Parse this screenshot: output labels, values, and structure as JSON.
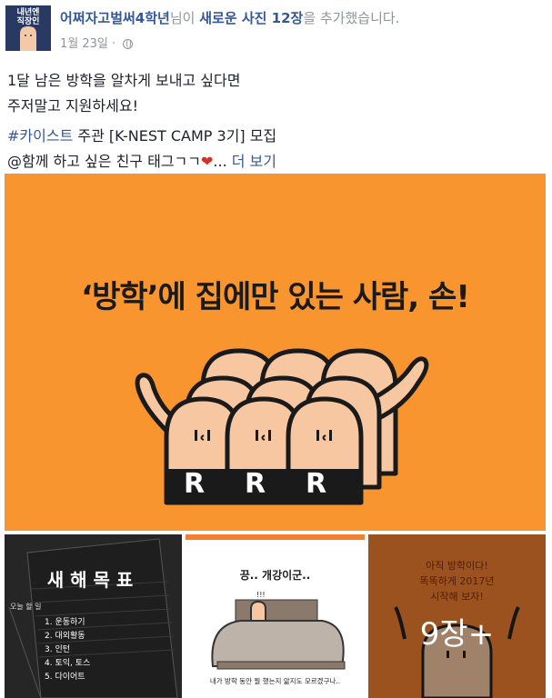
{
  "post": {
    "author": "어쩌자고벌써4학년",
    "action_mid": "님이 ",
    "highlight": "새로운 사진 12장",
    "action_end": "을 추가했습니다.",
    "date": "1월 23일",
    "date_sep": "·",
    "avatar_text": "내년엔\n직장인"
  },
  "body": {
    "line1": "1달 남은 방학을 알차게 보내고 싶다면",
    "line2": "주저말고 지원하세요!",
    "hashtag": "#카이스트",
    "line3_rest": " 주관 [K-NEST CAMP 3기] 모집",
    "line4": "@함께 하고 싶은 친구 태그ㄱㄱ",
    "heart": "❤",
    "ellipsis": "...",
    "more": "더 보기"
  },
  "main_image": {
    "title": "‘방학’에 집에만 있는 사람, 손!",
    "badge_letter": "R",
    "bg_color": "#f8952f"
  },
  "thumbnails": {
    "t1_title": "새해목표",
    "t1_items": [
      "1. 운동하기",
      "2. 대외활동",
      "3. 인턴",
      "4. 토익, 토스",
      "5. 다이어트"
    ],
    "t1_tab": "오늘 할 일",
    "t2_top": "끙.. 개강이군..",
    "t2_mark": "!!!",
    "t2_bottom": "내가 방학 동안 뭘 했는지 앎지도 모르겠구나..",
    "t3_line1": "아직 방학이다!",
    "t3_line2": "똑똑하게 2017년",
    "t3_line3": "시작해 보자!",
    "more_count": "9장+"
  }
}
